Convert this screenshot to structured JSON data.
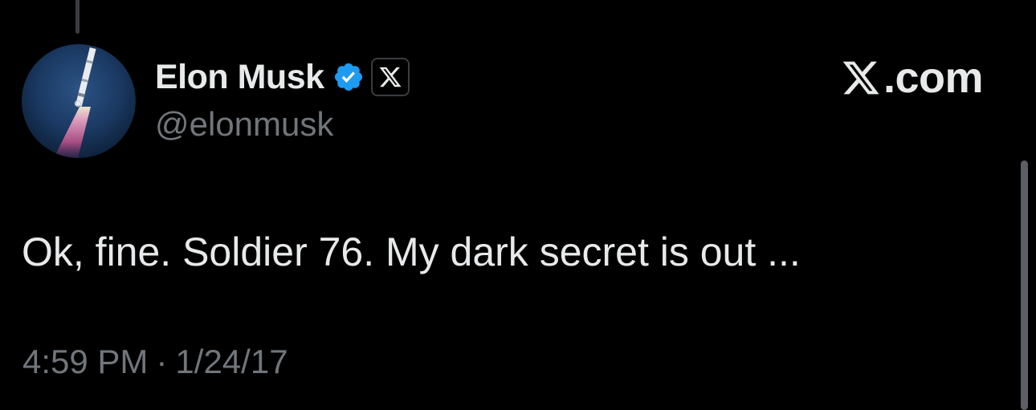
{
  "tweet": {
    "author": {
      "display_name": "Elon Musk",
      "handle": "@elonmusk",
      "avatar_icon": "rocket-launch-avatar",
      "verified_icon": "verified-check-icon",
      "affiliation_icon": "x-logo-icon"
    },
    "brand": {
      "label": ".com",
      "icon": "x-logo-icon"
    },
    "text": "Ok, fine. Soldier 76. My dark secret is out ...",
    "time": "4:59 PM",
    "separator": "·",
    "date": "1/24/17"
  },
  "colors": {
    "background": "#000000",
    "primary_text": "#e7e9ea",
    "secondary_text": "#71767b",
    "verified_blue": "#1d9bf0"
  }
}
